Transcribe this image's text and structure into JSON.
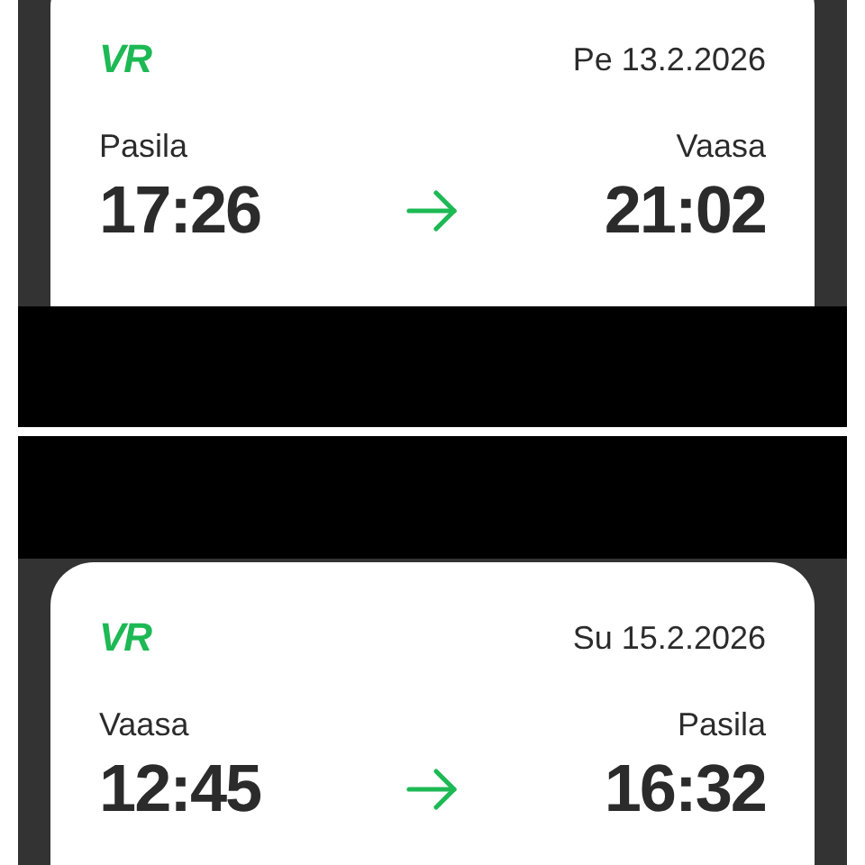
{
  "tickets": [
    {
      "logo": "VR",
      "date": "Pe 13.2.2026",
      "from": "Pasila",
      "to": "Vaasa",
      "departure": "17:26",
      "arrival": "21:02"
    },
    {
      "logo": "VR",
      "date": "Su 15.2.2026",
      "from": "Vaasa",
      "to": "Pasila",
      "departure": "12:45",
      "arrival": "16:32"
    }
  ]
}
